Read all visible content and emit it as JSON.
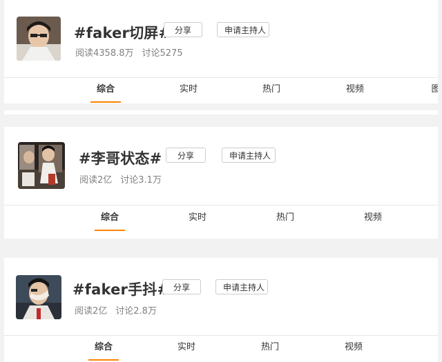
{
  "cards": [
    {
      "title": "#faker切屏#",
      "share_label": "分享",
      "host_label": "申请主持人",
      "reads": "阅读4358.8万",
      "discussions": "讨论5275",
      "tabs": [
        "综合",
        "实时",
        "热门",
        "视频",
        "图"
      ]
    },
    {
      "title": "#李哥状态#",
      "share_label": "分享",
      "host_label": "申请主持人",
      "reads": "阅读2亿",
      "discussions": "讨论3.1万",
      "tabs": [
        "综合",
        "实时",
        "热门",
        "视频"
      ]
    },
    {
      "title": "#faker手抖#",
      "share_label": "分享",
      "host_label": "申请主持人",
      "reads": "阅读2亿",
      "discussions": "讨论2.8万",
      "tabs": [
        "综合",
        "实时",
        "热门",
        "视频"
      ]
    }
  ],
  "colors": {
    "accent": "#ff8200",
    "title": "#333333",
    "meta": "#808080"
  }
}
